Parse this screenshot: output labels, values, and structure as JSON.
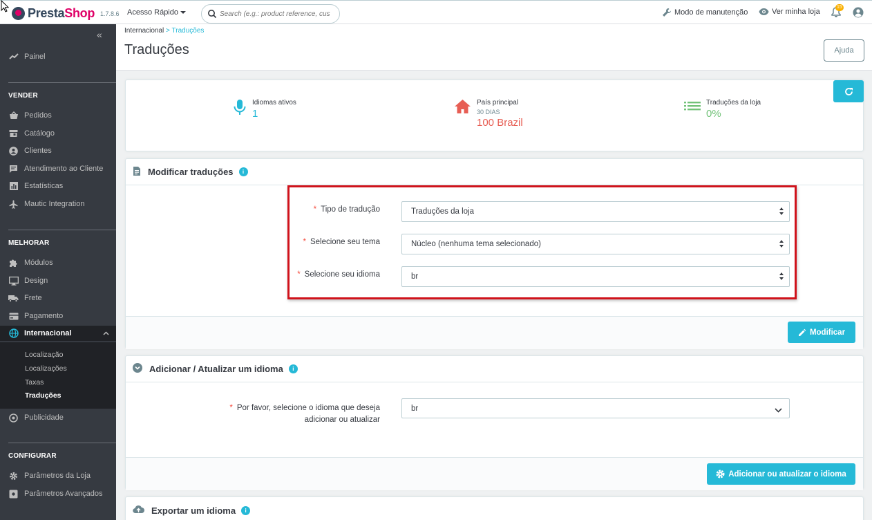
{
  "header": {
    "logo_brand": "Presta",
    "logo_brand2": "Shop",
    "version": "1.7.8.6",
    "quick_access": "Acesso Rápido",
    "search_placeholder": "Search (e.g.: product reference, custon",
    "maintenance": "Modo de manutenção",
    "view_shop": "Ver minha loja",
    "notifications_count": "15"
  },
  "sidebar": {
    "dashboard": "Painel",
    "sections": {
      "sell": "VENDER",
      "improve": "MELHORAR",
      "configure": "CONFIGURAR"
    },
    "sell_items": [
      "Pedidos",
      "Catálogo",
      "Clientes",
      "Atendimento ao Cliente",
      "Estatísticas",
      "Mautic Integration"
    ],
    "improve_items": [
      "Módulos",
      "Design",
      "Frete",
      "Pagamento",
      "Internacional"
    ],
    "international_sub": [
      "Localização",
      "Localizações",
      "Taxas",
      "Traduções"
    ],
    "advertising": "Publicidade",
    "configure_items": [
      "Parâmetros da Loja",
      "Parâmetros Avançados"
    ]
  },
  "page": {
    "breadcrumb_parent": "Internacional",
    "breadcrumb_sep": ">",
    "breadcrumb_current": "Traduções",
    "title": "Traduções",
    "help_button": "Ajuda"
  },
  "kpis": [
    {
      "title": "Idiomas ativos",
      "sub": "",
      "value": "1",
      "color": "#25b9d7",
      "icon": "microphone-icon"
    },
    {
      "title": "País principal",
      "sub": "30 DIAS",
      "value": "100 Brazil",
      "color": "#e75e54",
      "icon": "home-icon"
    },
    {
      "title": "Traduções da loja",
      "sub": "",
      "value": "0%",
      "color": "#72c279",
      "icon": "list-icon"
    }
  ],
  "modify_panel": {
    "title": "Modificar traduções",
    "fields": [
      {
        "label": "Tipo de tradução",
        "value": "Traduções da loja"
      },
      {
        "label": "Selecione seu tema",
        "value": "Núcleo (nenhuma tema selecionado)"
      },
      {
        "label": "Selecione seu idioma",
        "value": "br"
      }
    ],
    "required_mark": "*",
    "submit": "Modificar"
  },
  "add_panel": {
    "title": "Adicionar / Atualizar um idioma",
    "label_line1": "Por favor, selecione o idioma que deseja",
    "label_line2": "adicionar ou atualizar",
    "value": "br",
    "submit": "Adicionar ou atualizar o idioma"
  },
  "export_panel": {
    "title": "Exportar um idioma"
  },
  "colors": {
    "accent": "#25b9d7",
    "sidebar_bg": "#363a41",
    "highlight": "#d0121b"
  }
}
